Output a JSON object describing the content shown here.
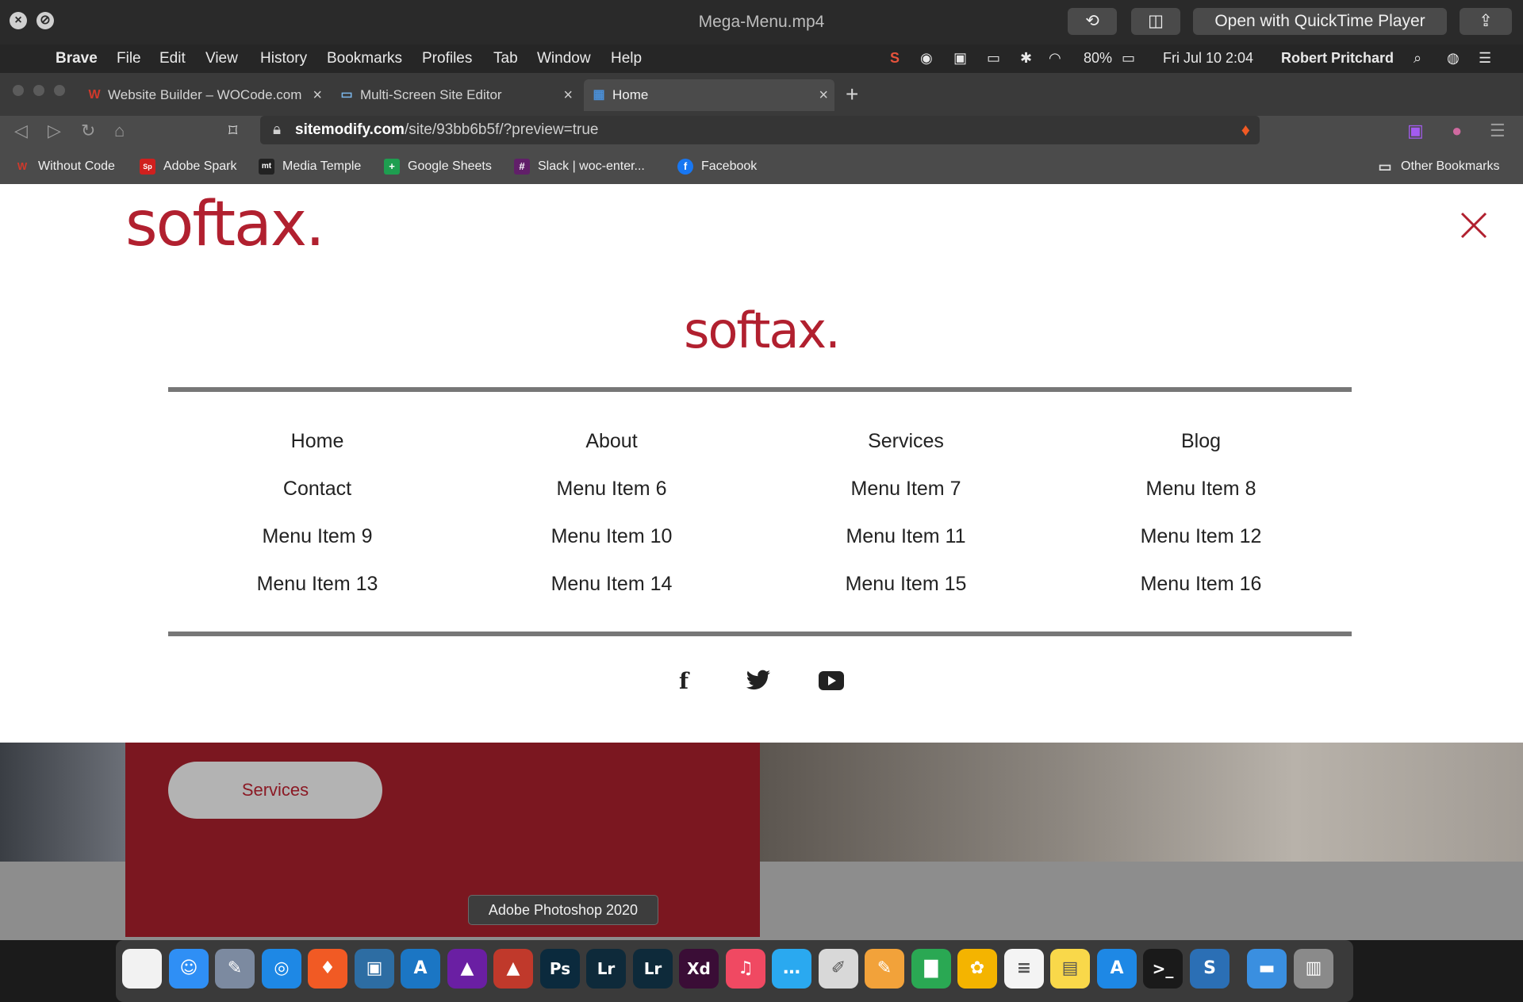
{
  "quicktime": {
    "title": "Mega-Menu.mp4",
    "open_with": "Open with QuickTime Player"
  },
  "menubar": {
    "app": "Brave",
    "items": [
      "File",
      "Edit",
      "View",
      "History",
      "Bookmarks",
      "Profiles",
      "Tab",
      "Window",
      "Help"
    ],
    "battery": "80%",
    "datetime": "Fri Jul 10  2:04",
    "user": "Robert Pritchard"
  },
  "tabs": [
    {
      "title": "Website Builder – WOCode.com",
      "icon": "W"
    },
    {
      "title": "Multi-Screen Site Editor",
      "icon": "▭"
    },
    {
      "title": "Home",
      "icon": "▦"
    }
  ],
  "address": {
    "host": "sitemodify.com",
    "path": "/site/93bb6b5f/?preview=true"
  },
  "bookmarks": [
    {
      "label": "Without Code",
      "icon": "W",
      "color": "#c0392b"
    },
    {
      "label": "Adobe Spark",
      "icon": "Sp",
      "color": "#d0201e"
    },
    {
      "label": "Media Temple",
      "icon": "mt",
      "color": "#222222"
    },
    {
      "label": "Google Sheets",
      "icon": "+",
      "color": "#1e9e50"
    },
    {
      "label": "Slack | woc-enter...",
      "icon": "#",
      "color": "#611f69"
    },
    {
      "label": "Facebook",
      "icon": "f",
      "color": "#1877f2"
    }
  ],
  "other_bookmarks": "Other Bookmarks",
  "site": {
    "logo": "softax.",
    "brand_color": "#b1202f",
    "menu": [
      [
        "Home",
        "About",
        "Services",
        "Blog"
      ],
      [
        "Contact",
        "Menu Item 6",
        "Menu Item 7",
        "Menu Item 8"
      ],
      [
        "Menu Item 9",
        "Menu Item 10",
        "Menu Item 11",
        "Menu Item 12"
      ],
      [
        "Menu Item 13",
        "Menu Item 14",
        "Menu Item 15",
        "Menu Item 16"
      ]
    ],
    "social_icons": [
      "facebook-icon",
      "twitter-icon",
      "youtube-icon"
    ],
    "services_button": "Services"
  },
  "dock_tooltip": "Adobe Photoshop 2020",
  "dock_apps": [
    {
      "name": "notes-app",
      "glyph": "",
      "color": "#f2f2f2"
    },
    {
      "name": "finder-app",
      "glyph": "☺",
      "color": "#2f8ff5"
    },
    {
      "name": "preview-app",
      "glyph": "✎",
      "color": "#7c8aa0"
    },
    {
      "name": "safari-app",
      "glyph": "◎",
      "color": "#1e88e5"
    },
    {
      "name": "brave-app",
      "glyph": "♦",
      "color": "#f15a24"
    },
    {
      "name": "screen-app",
      "glyph": "▣",
      "color": "#2d6da3"
    },
    {
      "name": "affinity-designer-app",
      "glyph": "A",
      "color": "#1b76c4"
    },
    {
      "name": "affinity-photo-app",
      "glyph": "▲",
      "color": "#6a1fa3"
    },
    {
      "name": "affinity-publisher-app",
      "glyph": "▲",
      "color": "#c0392b"
    },
    {
      "name": "photoshop-app",
      "glyph": "Ps",
      "color": "#0b2a3d"
    },
    {
      "name": "lightroom-classic-app",
      "glyph": "Lr",
      "color": "#0e2a3a"
    },
    {
      "name": "lightroom-app",
      "glyph": "Lr",
      "color": "#0e2a3a"
    },
    {
      "name": "xd-app",
      "glyph": "Xd",
      "color": "#3a0d36"
    },
    {
      "name": "music-app",
      "glyph": "♫",
      "color": "#f04962"
    },
    {
      "name": "messages-app",
      "glyph": "…",
      "color": "#2aa9f0"
    },
    {
      "name": "textedit-app",
      "glyph": "✐",
      "color": "#d8d8d8"
    },
    {
      "name": "pages-app",
      "glyph": "✎",
      "color": "#f2a23a"
    },
    {
      "name": "numbers-app",
      "glyph": "▇",
      "color": "#2aa853"
    },
    {
      "name": "photos-app",
      "glyph": "✿",
      "color": "#f4b400"
    },
    {
      "name": "reminders-app",
      "glyph": "≡",
      "color": "#f4f4f4"
    },
    {
      "name": "stickies-app",
      "glyph": "▤",
      "color": "#f9d84a"
    },
    {
      "name": "app-store-app",
      "glyph": "A",
      "color": "#1e88e5"
    },
    {
      "name": "terminal-app",
      "glyph": ">_",
      "color": "#1a1a1a"
    },
    {
      "name": "sitemodify-app",
      "glyph": "S",
      "color": "#2b6fb5"
    },
    {
      "name": "folder-app",
      "glyph": "▬",
      "color": "#3a8fe0"
    },
    {
      "name": "trash-app",
      "glyph": "▥",
      "color": "#8a8a8a"
    }
  ]
}
